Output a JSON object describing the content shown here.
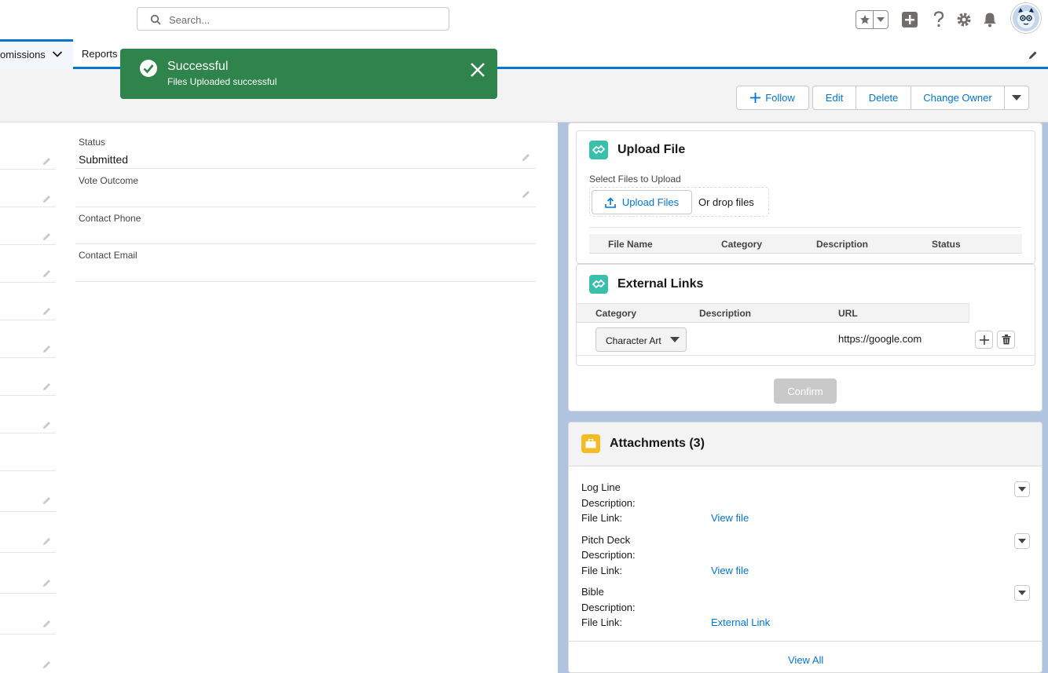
{
  "header": {
    "search_placeholder": "Search...",
    "icons": [
      "search-icon",
      "star-icon",
      "chevron-down-icon",
      "plus-icon",
      "help-icon",
      "gear-icon",
      "bell-icon",
      "avatar"
    ]
  },
  "nav": {
    "active_tab": "omissions",
    "reports_tab": "Reports"
  },
  "toast": {
    "title": "Successful",
    "message": "Files Uploaded successful",
    "color": "#2e844a"
  },
  "actions": {
    "follow": "Follow",
    "edit": "Edit",
    "delete": "Delete",
    "change_owner": "Change Owner"
  },
  "details": {
    "fields": [
      {
        "label": "Status",
        "value": "Submitted"
      },
      {
        "label": "Vote Outcome",
        "value": ""
      },
      {
        "label": "Contact Phone",
        "value": ""
      },
      {
        "label": "Contact Email",
        "value": ""
      }
    ]
  },
  "upload": {
    "title": "Upload File",
    "select_label": "Select Files to Upload",
    "upload_button": "Upload Files",
    "drop_text": "Or drop files",
    "columns": [
      "File Name",
      "Category",
      "Description",
      "Status"
    ]
  },
  "external_links": {
    "title": "External Links",
    "columns": [
      "Category",
      "Description",
      "URL"
    ],
    "row": {
      "category": "Character Art",
      "description": "",
      "url": "https://google.com"
    },
    "confirm": "Confirm"
  },
  "attachments": {
    "title": "Attachments (3)",
    "description_label": "Description:",
    "file_link_label": "File Link:",
    "items": [
      {
        "name": "Log Line",
        "description": "",
        "link": "View file"
      },
      {
        "name": "Pitch Deck",
        "description": "",
        "link": "View file"
      },
      {
        "name": "Bible",
        "description": "",
        "link": "External Link"
      }
    ],
    "view_all": "View All"
  },
  "colors": {
    "brand": "#0176d3",
    "teal_icon": "#3bbfad",
    "attachment_icon": "#f4bc25",
    "right_bg": "#b0c4df"
  }
}
